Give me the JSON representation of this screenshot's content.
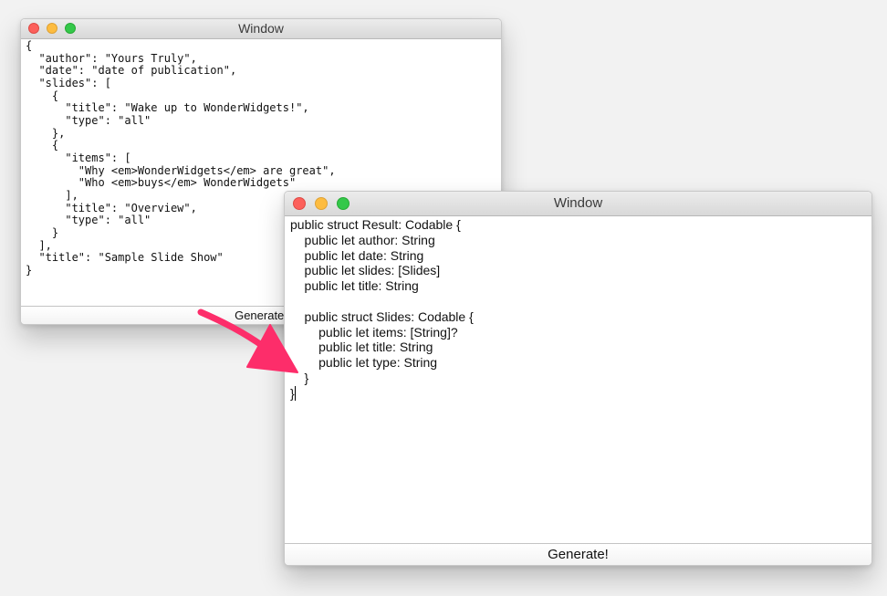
{
  "windows": [
    {
      "title": "Window",
      "content": "{\n  \"author\": \"Yours Truly\",\n  \"date\": \"date of publication\",\n  \"slides\": [\n    {\n      \"title\": \"Wake up to WonderWidgets!\",\n      \"type\": \"all\"\n    },\n    {\n      \"items\": [\n        \"Why <em>WonderWidgets</em> are great\",\n        \"Who <em>buys</em> WonderWidgets\"\n      ],\n      \"title\": \"Overview\",\n      \"type\": \"all\"\n    }\n  ],\n  \"title\": \"Sample Slide Show\"\n}",
      "button_label": "Generate!"
    },
    {
      "title": "Window",
      "content": "public struct Result: Codable {\n    public let author: String\n    public let date: String\n    public let slides: [Slides]\n    public let title: String\n\n    public struct Slides: Codable {\n        public let items: [String]?\n        public let title: String\n        public let type: String\n    }\n}",
      "button_label": "Generate!"
    }
  ],
  "icons": {
    "close": "close-icon",
    "minimize": "minimize-icon",
    "zoom": "zoom-icon",
    "arrow": "arrow-icon"
  },
  "colors": {
    "arrow": "#fd2d6a",
    "traffic_close": "#fc605b",
    "traffic_minimize": "#fdbc40",
    "traffic_zoom": "#34c84a"
  }
}
